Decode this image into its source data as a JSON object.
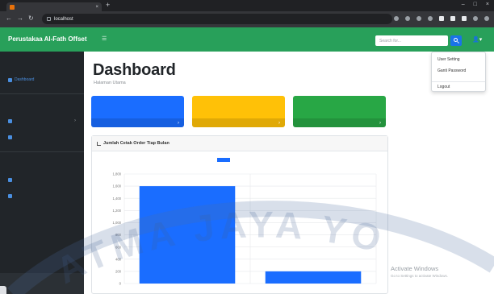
{
  "browser": {
    "tab_title": "",
    "url_host": "localhost",
    "url_path": ""
  },
  "navbar": {
    "brand": "Perustakaa Al-Fath Offset",
    "search_placeholder": "Search for...",
    "accent": "#28a05a"
  },
  "sidebar": {
    "sections": [
      {
        "heading": "",
        "items": [
          {
            "label": "Dashboard",
            "icon": "dashboard-icon",
            "has_chevron": false
          }
        ]
      },
      {
        "heading": "",
        "items": [
          {
            "label": "",
            "icon": "layout-icon",
            "has_chevron": true
          },
          {
            "label": "",
            "icon": "users-icon",
            "has_chevron": false
          }
        ]
      },
      {
        "heading": "",
        "items": [
          {
            "label": "",
            "icon": "cart-icon",
            "has_chevron": false
          },
          {
            "label": "",
            "icon": "report-icon",
            "has_chevron": false
          }
        ]
      }
    ],
    "footer_label": ""
  },
  "main": {
    "title": "Dashboard",
    "breadcrumb": "Halaman Utama"
  },
  "cards": [
    {
      "label": "",
      "value": "",
      "color": "#1a6dff"
    },
    {
      "label": "",
      "value": "",
      "color": "#ffc107"
    },
    {
      "label": "",
      "value": "",
      "color": "#28a745"
    }
  ],
  "chart": {
    "title": "Jumlah Cetak Order Tiap Bulan"
  },
  "chart_data": {
    "type": "bar",
    "title": "Jumlah Cetak Order Tiap Bulan",
    "categories": [
      "",
      ""
    ],
    "series": [
      {
        "name": "",
        "values": [
          1600,
          200
        ],
        "color": "#1a6dff"
      }
    ],
    "ylim": [
      0,
      1800
    ],
    "yticks": [
      "1,800",
      "1,600",
      "1,400",
      "1,200",
      "1,000",
      "800",
      "600",
      "400",
      "200",
      "0"
    ],
    "grid": true,
    "legend": "top-center"
  },
  "user_menu": {
    "items": [
      "User Setting",
      "Ganti Password",
      "Logout"
    ]
  },
  "watermark": {
    "text": "ATMA JAYA YO"
  },
  "windows_notice": {
    "title": "Activate Windows",
    "subtitle": "Go to Settings to activate Windows."
  },
  "status_bar": {
    "url": ""
  }
}
